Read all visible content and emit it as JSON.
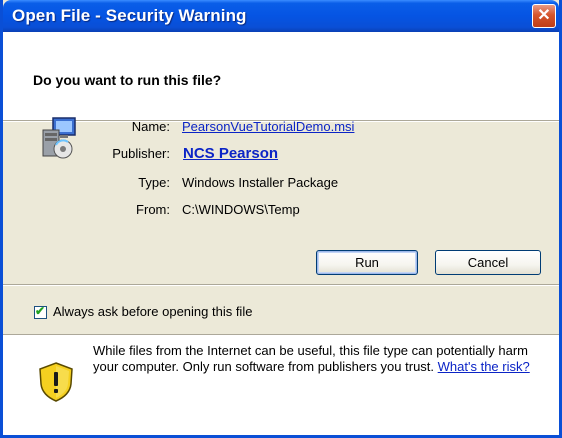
{
  "window": {
    "title": "Open File - Security Warning",
    "close_symbol": "✕"
  },
  "question": "Do you want to run this file?",
  "file": {
    "name_label": "Name:",
    "name_value": "PearsonVueTutorialDemo.msi",
    "publisher_label": "Publisher:",
    "publisher_value": "NCS Pearson",
    "type_label": "Type:",
    "type_value": "Windows Installer Package",
    "from_label": "From:",
    "from_value": "C:\\WINDOWS\\Temp"
  },
  "buttons": {
    "run": "Run",
    "cancel": "Cancel"
  },
  "checkbox": {
    "label": "Always ask before opening this file",
    "checked": true,
    "check_glyph": "✔"
  },
  "warning": {
    "text": "While files from the Internet can be useful, this file type can potentially harm your computer. Only run software from publishers you trust.",
    "link": "What's the risk?"
  },
  "icons": [
    "installer-package-icon",
    "shield-warning-icon",
    "close-icon"
  ],
  "colors": {
    "titlebar": "#0a4fd6",
    "link": "#0b24c6",
    "dialog_bg": "#ece9d8"
  }
}
